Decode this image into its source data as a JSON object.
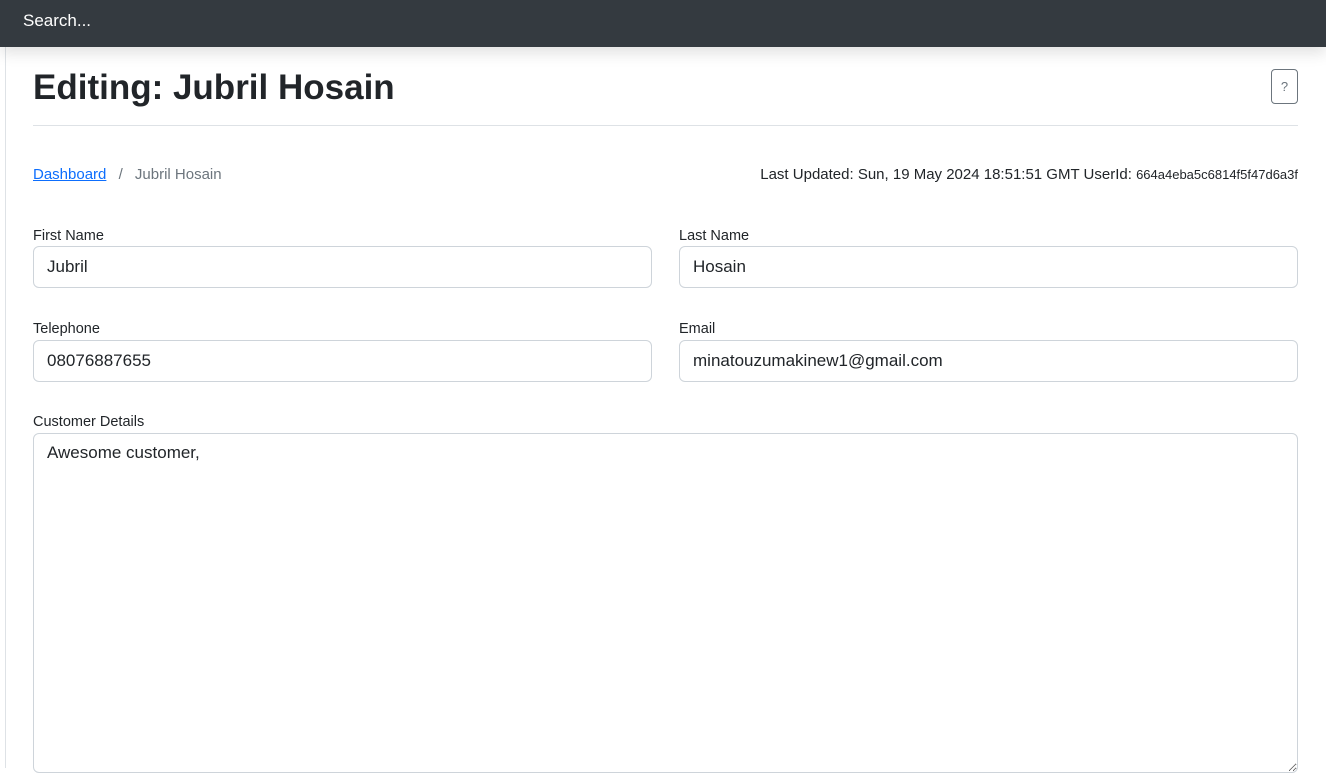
{
  "topbar": {
    "search_placeholder": "Search..."
  },
  "page": {
    "title": "Editing: Jubril Hosain",
    "help_label": "?"
  },
  "breadcrumb": {
    "dashboard_label": "Dashboard",
    "separator": "/",
    "current": "Jubril Hosain"
  },
  "meta": {
    "last_updated_label": "Last Updated:",
    "last_updated_value": "Sun, 19 May 2024 18:51:51 GMT",
    "userid_label": "UserId:",
    "userid_value": "664a4eba5c6814f5f47d6a3f"
  },
  "form": {
    "first_name": {
      "label": "First Name",
      "value": "Jubril"
    },
    "last_name": {
      "label": "Last Name",
      "value": "Hosain"
    },
    "telephone": {
      "label": "Telephone",
      "value": "08076887655"
    },
    "email": {
      "label": "Email",
      "value": "minatouzumakinew1@gmail.com"
    },
    "customer_details": {
      "label": "Customer Details",
      "value": "Awesome customer,"
    }
  },
  "colors": {
    "topbar_bg": "#343a40",
    "link": "#0d6efd",
    "muted": "#6c757d",
    "border": "#ced4da"
  }
}
